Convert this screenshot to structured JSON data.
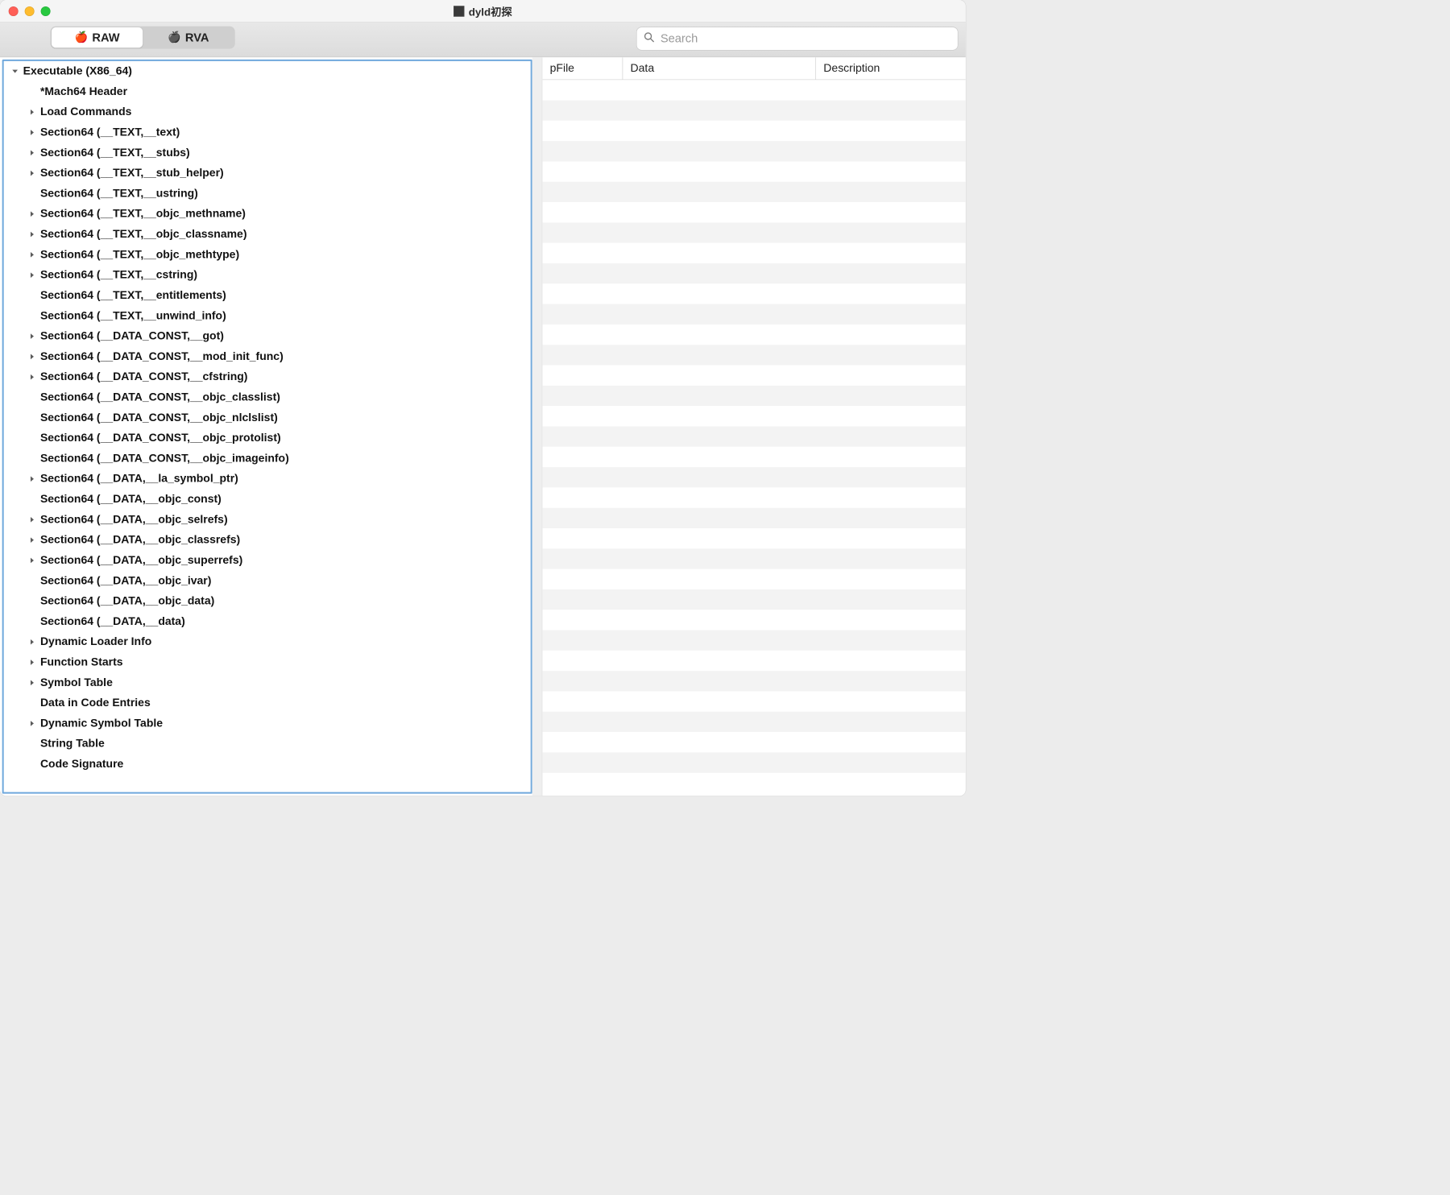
{
  "window": {
    "title": "dyld初探"
  },
  "toolbar": {
    "segmented": [
      {
        "label": "RAW",
        "active": true
      },
      {
        "label": "RVA",
        "active": false
      }
    ]
  },
  "search": {
    "placeholder": "Search",
    "value": ""
  },
  "table": {
    "columns": [
      "pFile",
      "Data",
      "Description"
    ]
  },
  "tree": {
    "root": {
      "label": "Executable  (X86_64)",
      "expanded": true,
      "children": [
        {
          "label": "*Mach64 Header",
          "expandable": false
        },
        {
          "label": "Load Commands",
          "expandable": true
        },
        {
          "label": "Section64 (__TEXT,__text)",
          "expandable": true
        },
        {
          "label": "Section64 (__TEXT,__stubs)",
          "expandable": true
        },
        {
          "label": "Section64 (__TEXT,__stub_helper)",
          "expandable": true
        },
        {
          "label": "Section64 (__TEXT,__ustring)",
          "expandable": false
        },
        {
          "label": "Section64 (__TEXT,__objc_methname)",
          "expandable": true
        },
        {
          "label": "Section64 (__TEXT,__objc_classname)",
          "expandable": true
        },
        {
          "label": "Section64 (__TEXT,__objc_methtype)",
          "expandable": true
        },
        {
          "label": "Section64 (__TEXT,__cstring)",
          "expandable": true
        },
        {
          "label": "Section64 (__TEXT,__entitlements)",
          "expandable": false
        },
        {
          "label": "Section64 (__TEXT,__unwind_info)",
          "expandable": false
        },
        {
          "label": "Section64 (__DATA_CONST,__got)",
          "expandable": true
        },
        {
          "label": "Section64 (__DATA_CONST,__mod_init_func)",
          "expandable": true
        },
        {
          "label": "Section64 (__DATA_CONST,__cfstring)",
          "expandable": true
        },
        {
          "label": "Section64 (__DATA_CONST,__objc_classlist)",
          "expandable": false
        },
        {
          "label": "Section64 (__DATA_CONST,__objc_nlclslist)",
          "expandable": false
        },
        {
          "label": "Section64 (__DATA_CONST,__objc_protolist)",
          "expandable": false
        },
        {
          "label": "Section64 (__DATA_CONST,__objc_imageinfo)",
          "expandable": false
        },
        {
          "label": "Section64 (__DATA,__la_symbol_ptr)",
          "expandable": true
        },
        {
          "label": "Section64 (__DATA,__objc_const)",
          "expandable": false
        },
        {
          "label": "Section64 (__DATA,__objc_selrefs)",
          "expandable": true
        },
        {
          "label": "Section64 (__DATA,__objc_classrefs)",
          "expandable": true
        },
        {
          "label": "Section64 (__DATA,__objc_superrefs)",
          "expandable": true
        },
        {
          "label": "Section64 (__DATA,__objc_ivar)",
          "expandable": false
        },
        {
          "label": "Section64 (__DATA,__objc_data)",
          "expandable": false
        },
        {
          "label": "Section64 (__DATA,__data)",
          "expandable": false
        },
        {
          "label": "Dynamic Loader Info",
          "expandable": true
        },
        {
          "label": "Function Starts",
          "expandable": true
        },
        {
          "label": "Symbol Table",
          "expandable": true
        },
        {
          "label": "Data in Code Entries",
          "expandable": false
        },
        {
          "label": "Dynamic Symbol Table",
          "expandable": true
        },
        {
          "label": "String Table",
          "expandable": false
        },
        {
          "label": "Code Signature",
          "expandable": false
        }
      ]
    }
  },
  "stripe_rows": 34
}
